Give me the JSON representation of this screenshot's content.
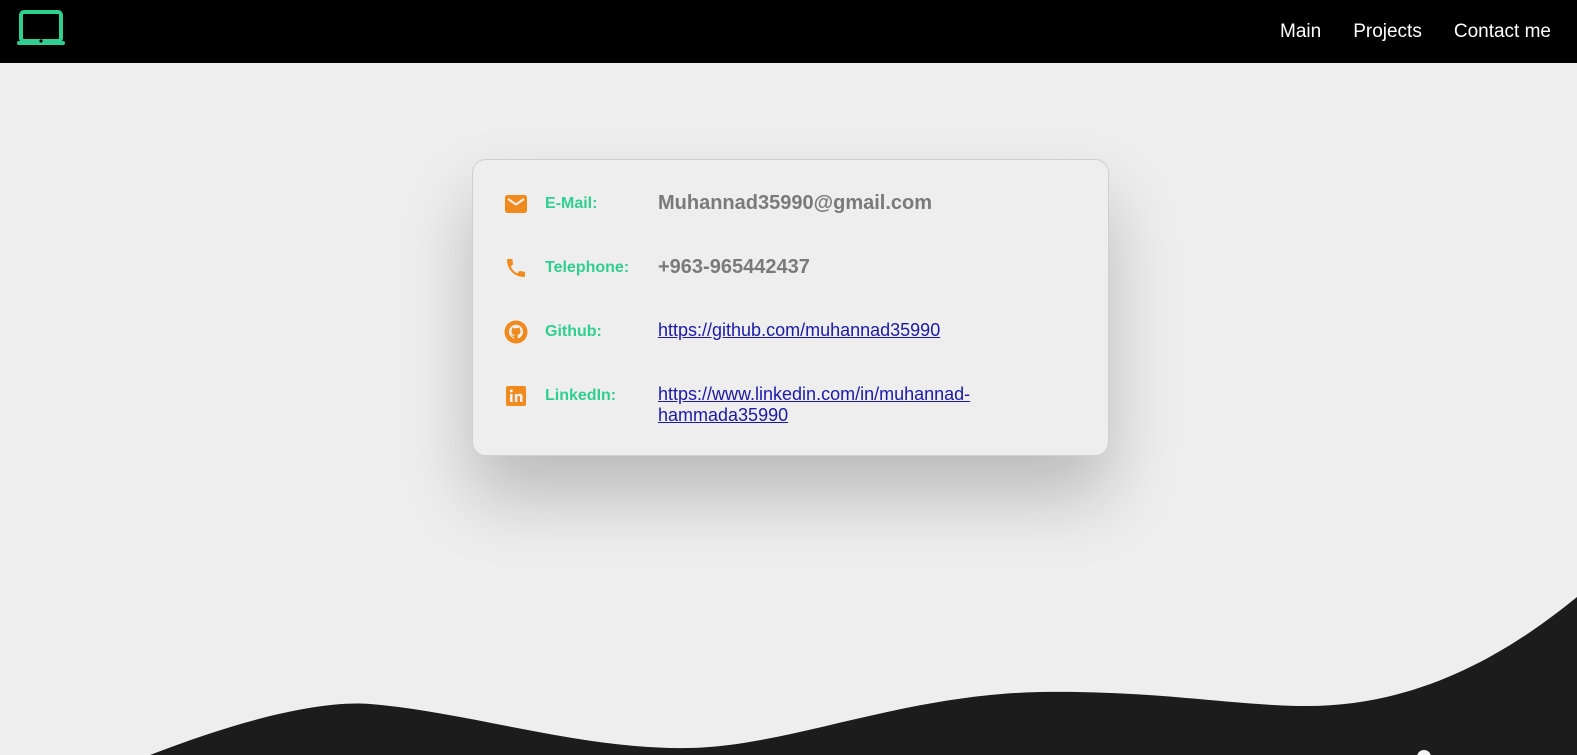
{
  "header": {
    "logo_icon": "laptop-icon",
    "nav": [
      {
        "label": "Main"
      },
      {
        "label": "Projects"
      },
      {
        "label": "Contact me"
      }
    ]
  },
  "contact": {
    "email": {
      "icon": "mail-icon",
      "label": "E-Mail:",
      "value": "Muhannad35990@gmail.com"
    },
    "telephone": {
      "icon": "phone-icon",
      "label": "Telephone:",
      "value": "+963-965442437"
    },
    "github": {
      "icon": "github-icon",
      "label": "Github:",
      "value": "https://github.com/muhannad35990"
    },
    "linkedin": {
      "icon": "linkedin-icon",
      "label": "LinkedIn:",
      "value": "https://www.linkedin.com/in/muhannad-hammada35990"
    }
  },
  "colors": {
    "navbar": "#000000",
    "accent_green": "#2fd08f",
    "icon_orange": "#f08a1c",
    "link": "#1a1aa6",
    "wave": "#1c1c1c"
  }
}
